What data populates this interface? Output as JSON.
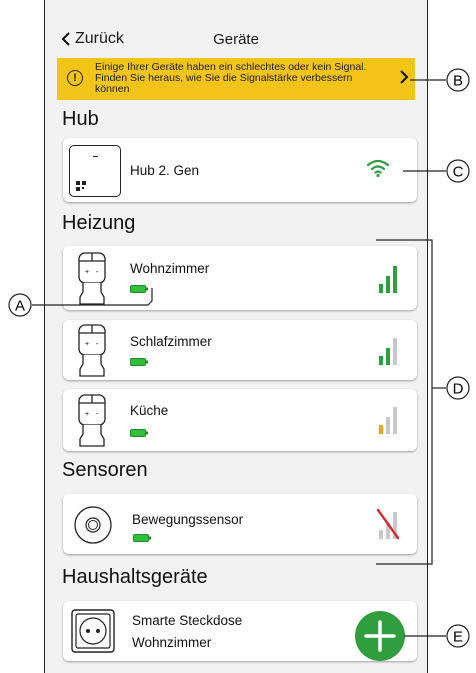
{
  "header": {
    "back_label": "Zurück",
    "title": "Geräte"
  },
  "banner": {
    "text": "Einige Ihrer Geräte haben ein schlechtes oder kein Signal. Finden Sie heraus, wie Sie die Signalstärke verbessern können",
    "color": "#f2c417"
  },
  "sections": {
    "hub": "Hub",
    "heating": "Heizung",
    "sensors": "Sensoren",
    "household": "Haushaltsgeräte"
  },
  "hub_card": {
    "name": "Hub 2. Gen",
    "icon_dash": "-",
    "status_icon": "wifi-icon",
    "status_color": "#2f9e3f"
  },
  "heating_devices": [
    {
      "name": "Wohnzimmer",
      "signal_bars": 3,
      "signal_color": "#2f9e3f",
      "battery_color": "#2fbf3a"
    },
    {
      "name": "Schlafzimmer",
      "signal_bars": 2,
      "signal_color": "#2f9e3f",
      "battery_color": "#2fbf3a"
    },
    {
      "name": "Küche",
      "signal_bars": 1,
      "signal_color": "#f0a21a",
      "battery_color": "#2fbf3a"
    }
  ],
  "sensor_devices": [
    {
      "name": "Bewegungssensor",
      "signal_bars": 0,
      "no_signal_color": "#d8282f",
      "battery_color": "#2fbf3a"
    }
  ],
  "household_devices": [
    {
      "name_line1": "Smarte Steckdose",
      "name_line2": "Wohnzimmer"
    }
  ],
  "fab": {
    "icon": "plus-icon",
    "color": "#2f9e3f"
  },
  "callouts": {
    "a": "A",
    "b": "B",
    "c": "C",
    "d": "D",
    "e": "E"
  }
}
